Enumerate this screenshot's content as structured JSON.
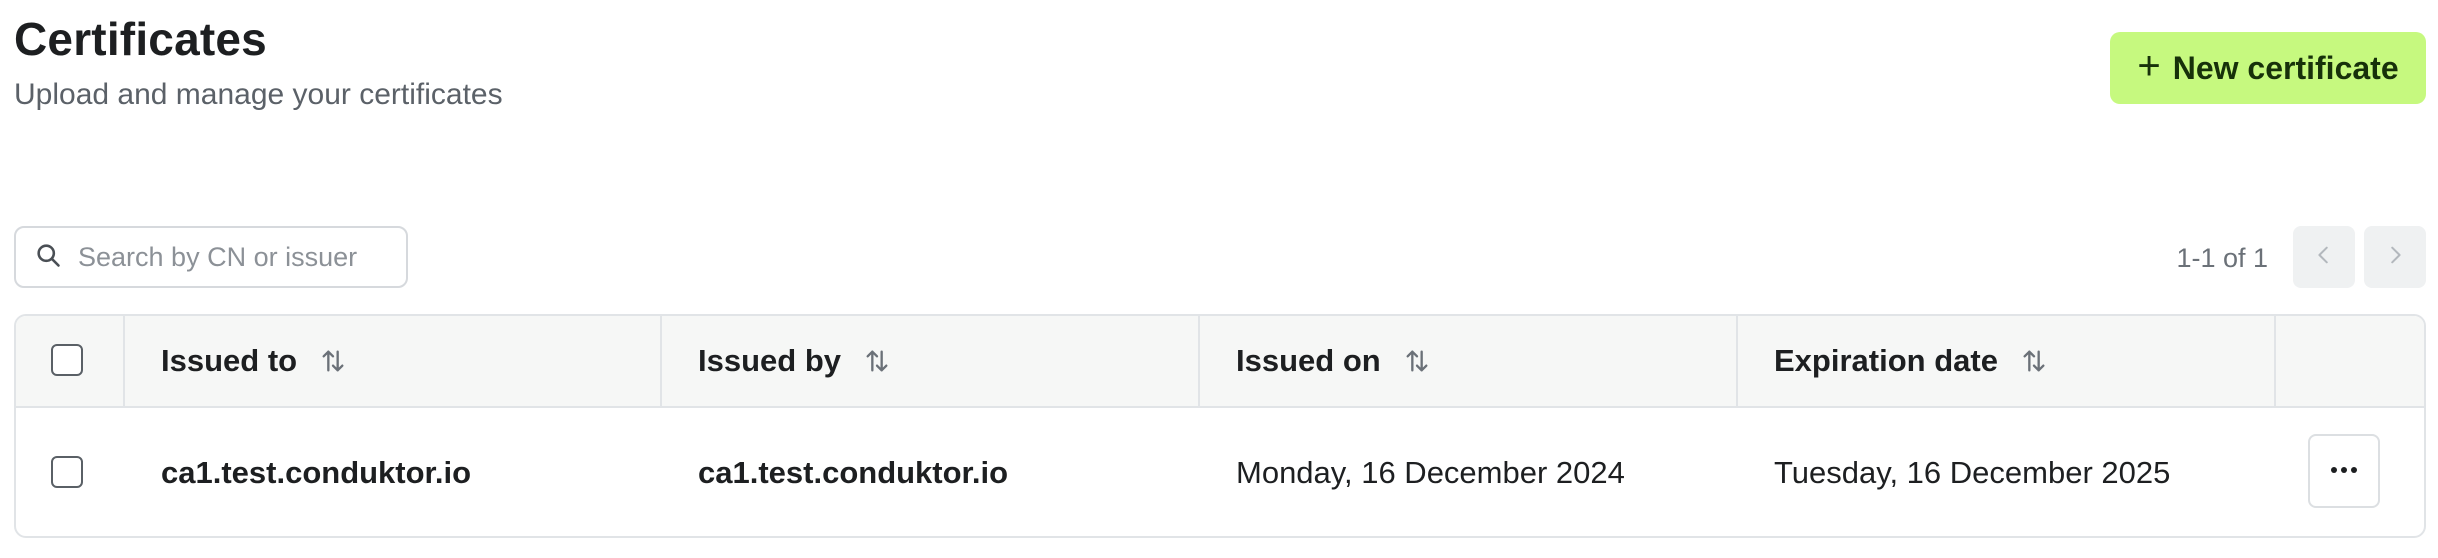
{
  "header": {
    "title": "Certificates",
    "subtitle": "Upload and manage your certificates",
    "new_button_label": "New certificate"
  },
  "search": {
    "placeholder": "Search by CN or issuer",
    "value": ""
  },
  "pagination": {
    "range_text": "1-1 of 1"
  },
  "table": {
    "columns": [
      "Issued to",
      "Issued by",
      "Issued on",
      "Expiration date"
    ],
    "rows": [
      {
        "issued_to": "ca1.test.conduktor.io",
        "issued_by": "ca1.test.conduktor.io",
        "issued_on": "Monday, 16 December 2024",
        "expiration_date": "Tuesday, 16 December 2025"
      }
    ]
  },
  "colors": {
    "accent": "#c6f97f",
    "accent_text": "#17310a",
    "header_bg": "#f6f7f6",
    "border": "#e1e4e7"
  },
  "icons": [
    "plus-icon",
    "search-icon",
    "chevron-left-icon",
    "chevron-right-icon",
    "sort-icon",
    "more-horizontal-icon"
  ]
}
